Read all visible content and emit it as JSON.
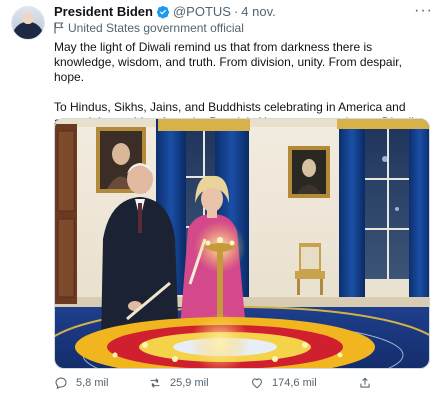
{
  "author": {
    "name": "President Biden",
    "handle": "@POTUS",
    "separator": "·",
    "time": "4 nov.",
    "label": "United States government official"
  },
  "tweet": {
    "paragraph1": "May the light of Diwali remind us that from darkness there is knowledge, wisdom, and truth. From division, unity. From despair, hope.",
    "paragraph2": "To Hindus, Sikhs, Jains, and Buddhists celebrating in America and around the world — from the People's House to yours, happy Diwali."
  },
  "stats": {
    "replies": "5,8 mil",
    "retweets": "25,9 mil",
    "likes": "174,6 mil"
  },
  "icons": {
    "verified": "verified-badge-icon",
    "label": "government-flag-icon",
    "more": "more-dots-icon",
    "reply": "reply-icon",
    "retweet": "retweet-icon",
    "like": "like-heart-icon",
    "share": "share-icon"
  },
  "colors": {
    "verified": "#1d9bf0",
    "secondary_text": "#536471",
    "text": "#0f1419"
  }
}
